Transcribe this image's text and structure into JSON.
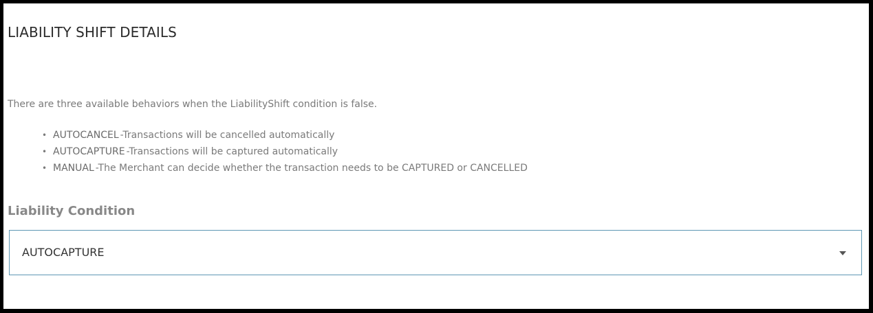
{
  "section": {
    "title": "LIABILITY SHIFT DETAILS",
    "intro": "There are three available behaviors when the LiabilityShift condition is false."
  },
  "behaviors": [
    {
      "name": "AUTOCANCEL",
      "description": "-Transactions will be cancelled automatically"
    },
    {
      "name": "AUTOCAPTURE",
      "description": "-Transactions will be captured automatically"
    },
    {
      "name": "MANUAL",
      "description": "-The Merchant can decide whether the transaction needs to be CAPTURED or CANCELLED"
    }
  ],
  "bullet": "•",
  "field": {
    "label": "Liability Condition",
    "selected_value": "AUTOCAPTURE",
    "caret_icon": "caret-down-icon"
  },
  "colors": {
    "select_border": "#5d97b3",
    "frame_border": "#000000"
  }
}
